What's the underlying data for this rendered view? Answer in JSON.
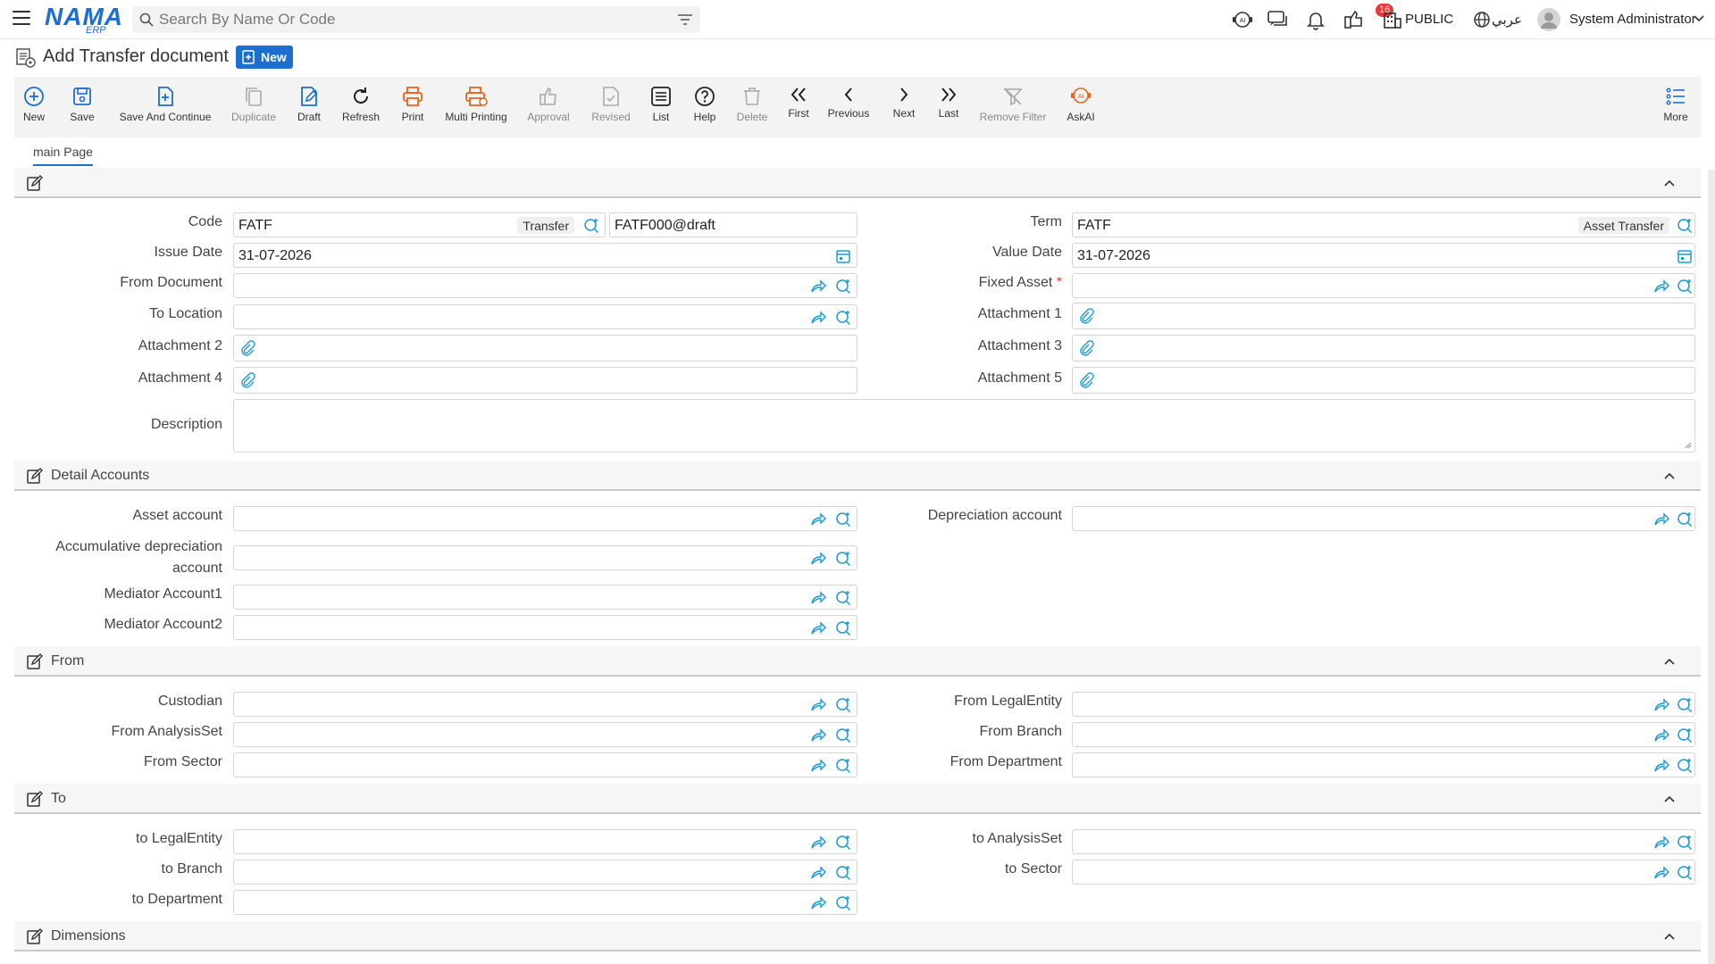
{
  "topbar": {
    "logo": "NAMA",
    "logo_sub": "ERP",
    "search_placeholder": "Search By Name Or Code",
    "notification_count": "16",
    "company": "PUBLIC",
    "language": "عربي",
    "user": "System Administrator"
  },
  "page": {
    "title": "Add Transfer document",
    "badge": "New"
  },
  "toolbar": {
    "new": "New",
    "save": "Save",
    "save_continue": "Save And Continue",
    "duplicate": "Duplicate",
    "draft": "Draft",
    "refresh": "Refresh",
    "print": "Print",
    "multi_printing": "Multi Printing",
    "approval": "Approval",
    "revised": "Revised",
    "list": "List",
    "help": "Help",
    "delete": "Delete",
    "first": "First",
    "previous": "Previous",
    "next": "Next",
    "last": "Last",
    "remove_filter": "Remove Filter",
    "askai": "AskAI",
    "more": "More"
  },
  "tabs": {
    "main": "main Page"
  },
  "main": {
    "code_label": "Code",
    "code_value": "FATF",
    "code_tag": "Transfer",
    "code_number": "FATF000@draft",
    "term_label": "Term",
    "term_value": "FATF",
    "term_tag": "Asset Transfer",
    "issue_date_label": "Issue Date",
    "issue_date": "31-07-2026",
    "value_date_label": "Value Date",
    "value_date": "31-07-2026",
    "from_document_label": "From Document",
    "fixed_asset_label": "Fixed Asset",
    "required_mark": "*",
    "to_location_label": "To Location",
    "attachment1_label": "Attachment 1",
    "attachment2_label": "Attachment 2",
    "attachment3_label": "Attachment 3",
    "attachment4_label": "Attachment 4",
    "attachment5_label": "Attachment 5",
    "description_label": "Description"
  },
  "detail_accounts": {
    "title": "Detail Accounts",
    "asset_account": "Asset account",
    "depreciation_account": "Depreciation account",
    "accumulative_line1": "Accumulative depreciation",
    "accumulative_line2": "account",
    "mediator1": "Mediator Account1",
    "mediator2": "Mediator Account2"
  },
  "from": {
    "title": "From",
    "custodian": "Custodian",
    "legal_entity": "From LegalEntity",
    "analysis_set": "From AnalysisSet",
    "branch": "From Branch",
    "sector": "From Sector",
    "department": "From Department"
  },
  "to": {
    "title": "To",
    "legal_entity": "to LegalEntity",
    "analysis_set": "to AnalysisSet",
    "branch": "to Branch",
    "sector": "to Sector",
    "department": "to Department"
  },
  "dimensions": {
    "title": "Dimensions"
  },
  "colors": {
    "accent": "#1b6fd1",
    "orange": "#e8651e",
    "badge_red": "#e53935"
  }
}
